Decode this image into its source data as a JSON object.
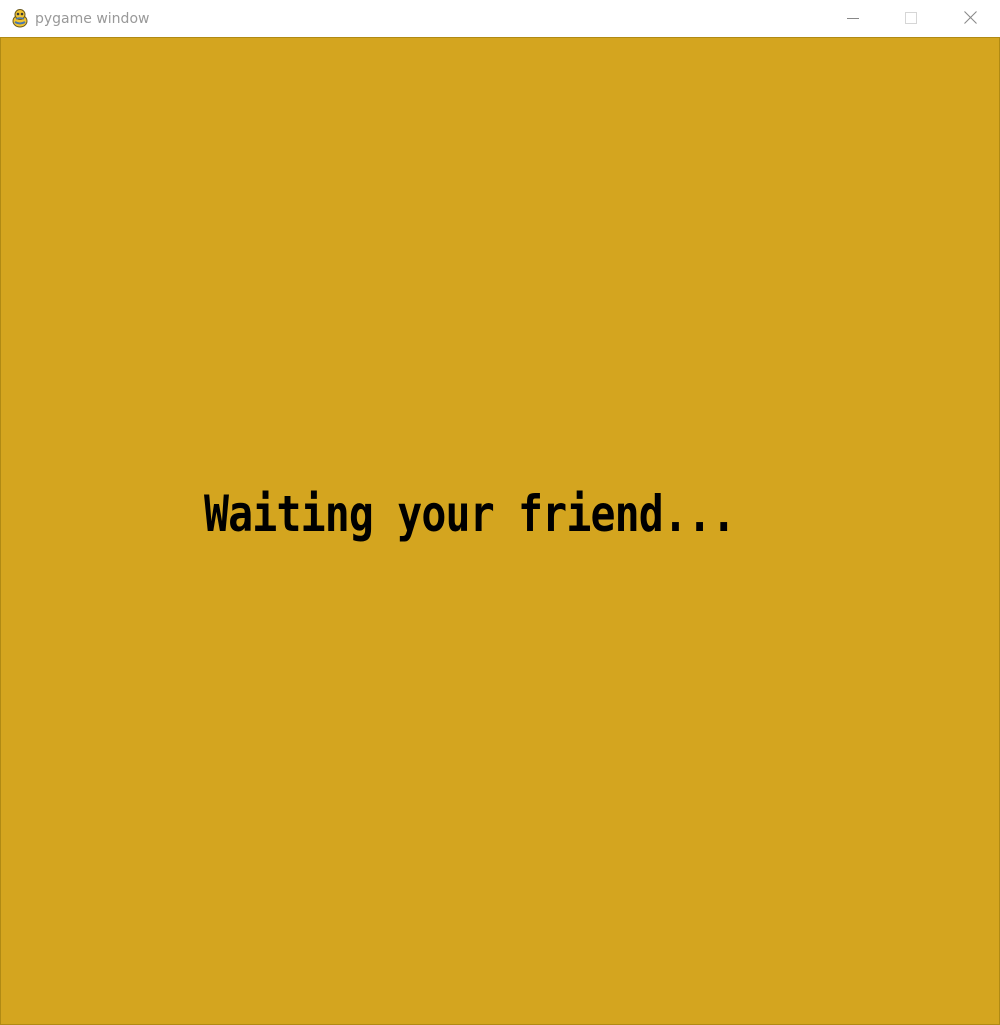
{
  "window": {
    "title": "pygame window",
    "icon": "pygame-snake-icon",
    "controls": {
      "minimize_icon": "minimize-icon",
      "maximize_icon": "maximize-icon",
      "close_icon": "close-icon"
    }
  },
  "game": {
    "background_color": "#d4a51f",
    "text_color": "#000000",
    "status_text": "Waiting your friend..."
  }
}
